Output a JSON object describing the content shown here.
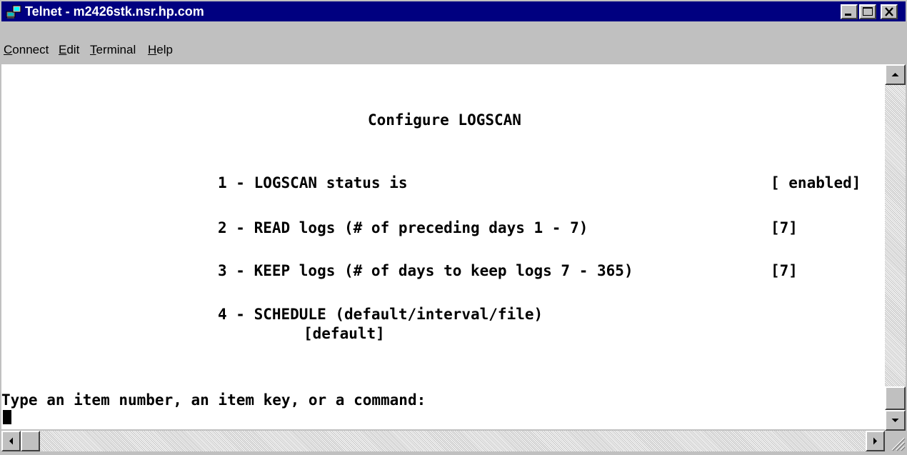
{
  "window": {
    "title": "Telnet - m2426stk.nsr.hp.com",
    "icon": "telnet-computer-icon"
  },
  "menu": {
    "connect": {
      "mnemonic": "C",
      "rest": "onnect"
    },
    "edit": {
      "mnemonic": "E",
      "rest": "dit"
    },
    "terminal": {
      "mnemonic": "T",
      "rest": "erminal"
    },
    "help": {
      "mnemonic": "H",
      "rest": "elp"
    }
  },
  "terminal": {
    "heading": "Configure LOGSCAN",
    "items": [
      {
        "text": "1 - LOGSCAN status is",
        "value": "[ enabled]"
      },
      {
        "text": "2 - READ logs (# of preceding days 1 - 7)",
        "value": "[7]"
      },
      {
        "text": "3 - KEEP logs (# of days to keep logs 7 - 365)",
        "value": "[7]"
      },
      {
        "text": "4 - SCHEDULE (default/interval/file)",
        "value": "[default]"
      }
    ],
    "prompt": "Type an item number, an item key, or a command:"
  },
  "colors": {
    "titlebar": "#000080",
    "face": "#c0c0c0",
    "terminal_bg": "#ffffff",
    "terminal_fg": "#000000"
  }
}
